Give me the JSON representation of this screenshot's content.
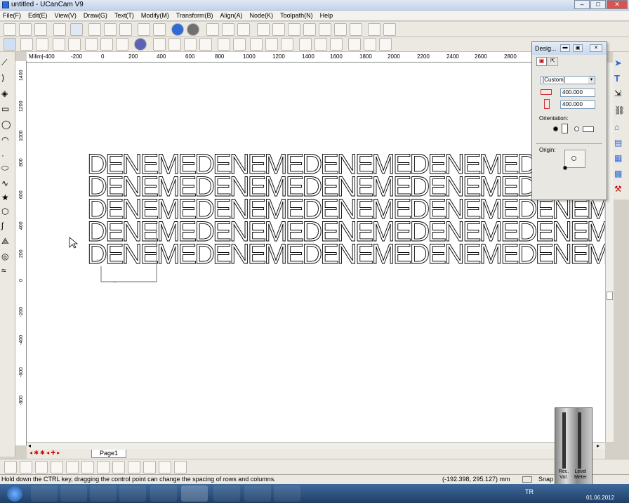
{
  "window": {
    "title": "untitled - UCanCam V9"
  },
  "menu": [
    "File(F)",
    "Edit(E)",
    "View(V)",
    "Draw(G)",
    "Text(T)",
    "Modify(M)",
    "Transform(B)",
    "Align(A)",
    "Node(K)",
    "Toolpath(N)",
    "Help"
  ],
  "ruler": {
    "unit_label": "Milim|-400",
    "h_ticks": [
      "-200",
      "0",
      "200",
      "400",
      "600",
      "800",
      "1000",
      "1200",
      "1400",
      "1600",
      "1800",
      "2000",
      "2200",
      "2400",
      "2600",
      "2800"
    ],
    "v_ticks": [
      "1400",
      "1200",
      "1000",
      "800",
      "600",
      "400",
      "200",
      "0",
      "-200",
      "-400",
      "-600",
      "-800"
    ]
  },
  "canvas": {
    "text_row": "DENEMEDENEMEDENEMEDENEMEDENEMEDE"
  },
  "pagetabs": {
    "page": "Page1"
  },
  "design_panel": {
    "title": "Desig...",
    "preset": "[Custom]",
    "width_value": "400.000",
    "height_value": "400.000",
    "orientation_label": "Orientation:",
    "origin_label": "Origin:"
  },
  "status": {
    "hint": "Hold down the CTRL key, dragging the control point can change the spacing of rows and columns.",
    "coords": "(-192.398, 295.127) mm",
    "snap": "Snap"
  },
  "meter": {
    "rec_label": "Rec. Vol.",
    "level_label": "Level Meter"
  },
  "taskbar": {
    "lang": "TR",
    "date": "01.06.2012"
  },
  "colors": {
    "accent": "#2e6bd6",
    "taskbar": "#203e66"
  }
}
